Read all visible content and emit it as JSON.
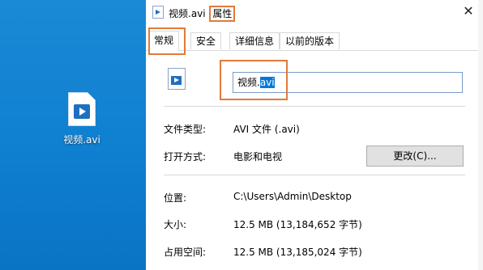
{
  "desktop": {
    "file_icon": "video-file-icon",
    "file_label": "视频.avi"
  },
  "dialog": {
    "title_prefix": "视频.avi ",
    "title_highlight": "属性",
    "close_glyph": "✕",
    "tabs": [
      {
        "label": "常规",
        "active": true
      },
      {
        "label": "安全"
      },
      {
        "label": "详细信息"
      },
      {
        "label": "以前的版本"
      }
    ],
    "name_prefix": "视频.",
    "name_selected": "avi",
    "file_type_label": "文件类型:",
    "file_type_value": "AVI 文件 (.avi)",
    "open_with_label": "打开方式:",
    "open_with_value": "电影和电视",
    "change_button": "更改(C)...",
    "location_label": "位置:",
    "location_value": "C:\\Users\\Admin\\Desktop",
    "size_label": "大小:",
    "size_value": "12.5 MB (13,184,652 字节)",
    "disk_size_label": "占用空间:",
    "disk_size_value": "12.5 MB (13,185,024 字节)"
  },
  "colors": {
    "desktop_bg": "#0f7fd0",
    "highlight_box": "#e07b39",
    "selection": "#0078d7"
  }
}
